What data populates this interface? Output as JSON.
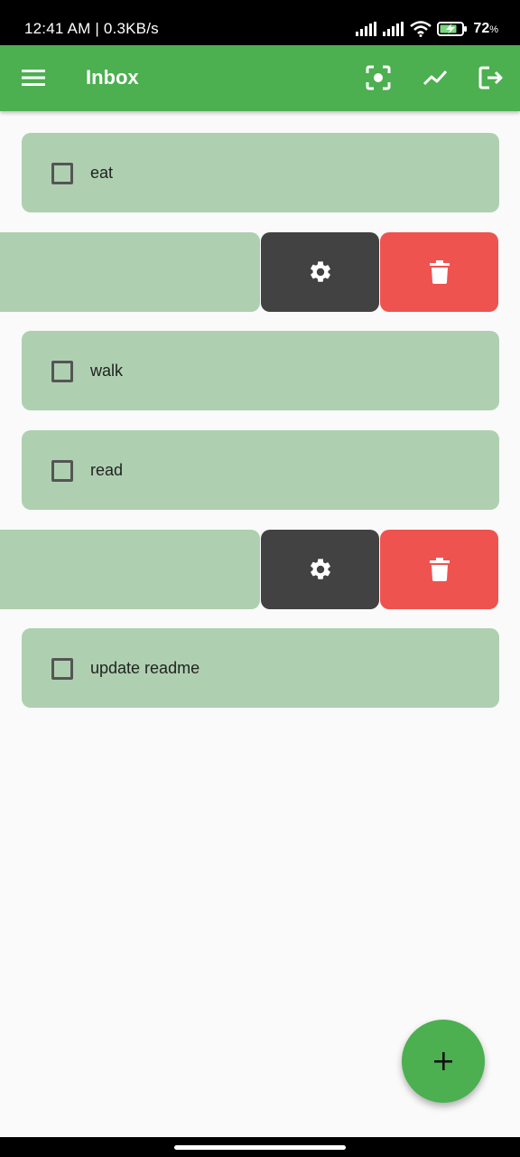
{
  "status_bar": {
    "time": "12:41 AM | 0.3KB/s",
    "battery_percent": "72",
    "battery_unit": "%"
  },
  "app_bar": {
    "title": "Inbox",
    "color": "#4caf50",
    "icons": [
      "menu-icon",
      "scan-icon",
      "trend-icon",
      "logout-icon"
    ]
  },
  "tasks": [
    {
      "label": "eat",
      "checked": false
    },
    {
      "label": "",
      "swiped": true,
      "actions": [
        "settings",
        "delete"
      ]
    },
    {
      "label": "walk",
      "checked": false
    },
    {
      "label": "read",
      "checked": false
    },
    {
      "label": "",
      "swiped": true,
      "actions": [
        "settings",
        "delete"
      ]
    },
    {
      "label": "update readme",
      "checked": false
    }
  ],
  "colors": {
    "card": "#aed0b0",
    "settings_action": "#424242",
    "delete_action": "#ef5350",
    "fab": "#4caf50"
  },
  "fab": {
    "icon": "plus-icon"
  }
}
